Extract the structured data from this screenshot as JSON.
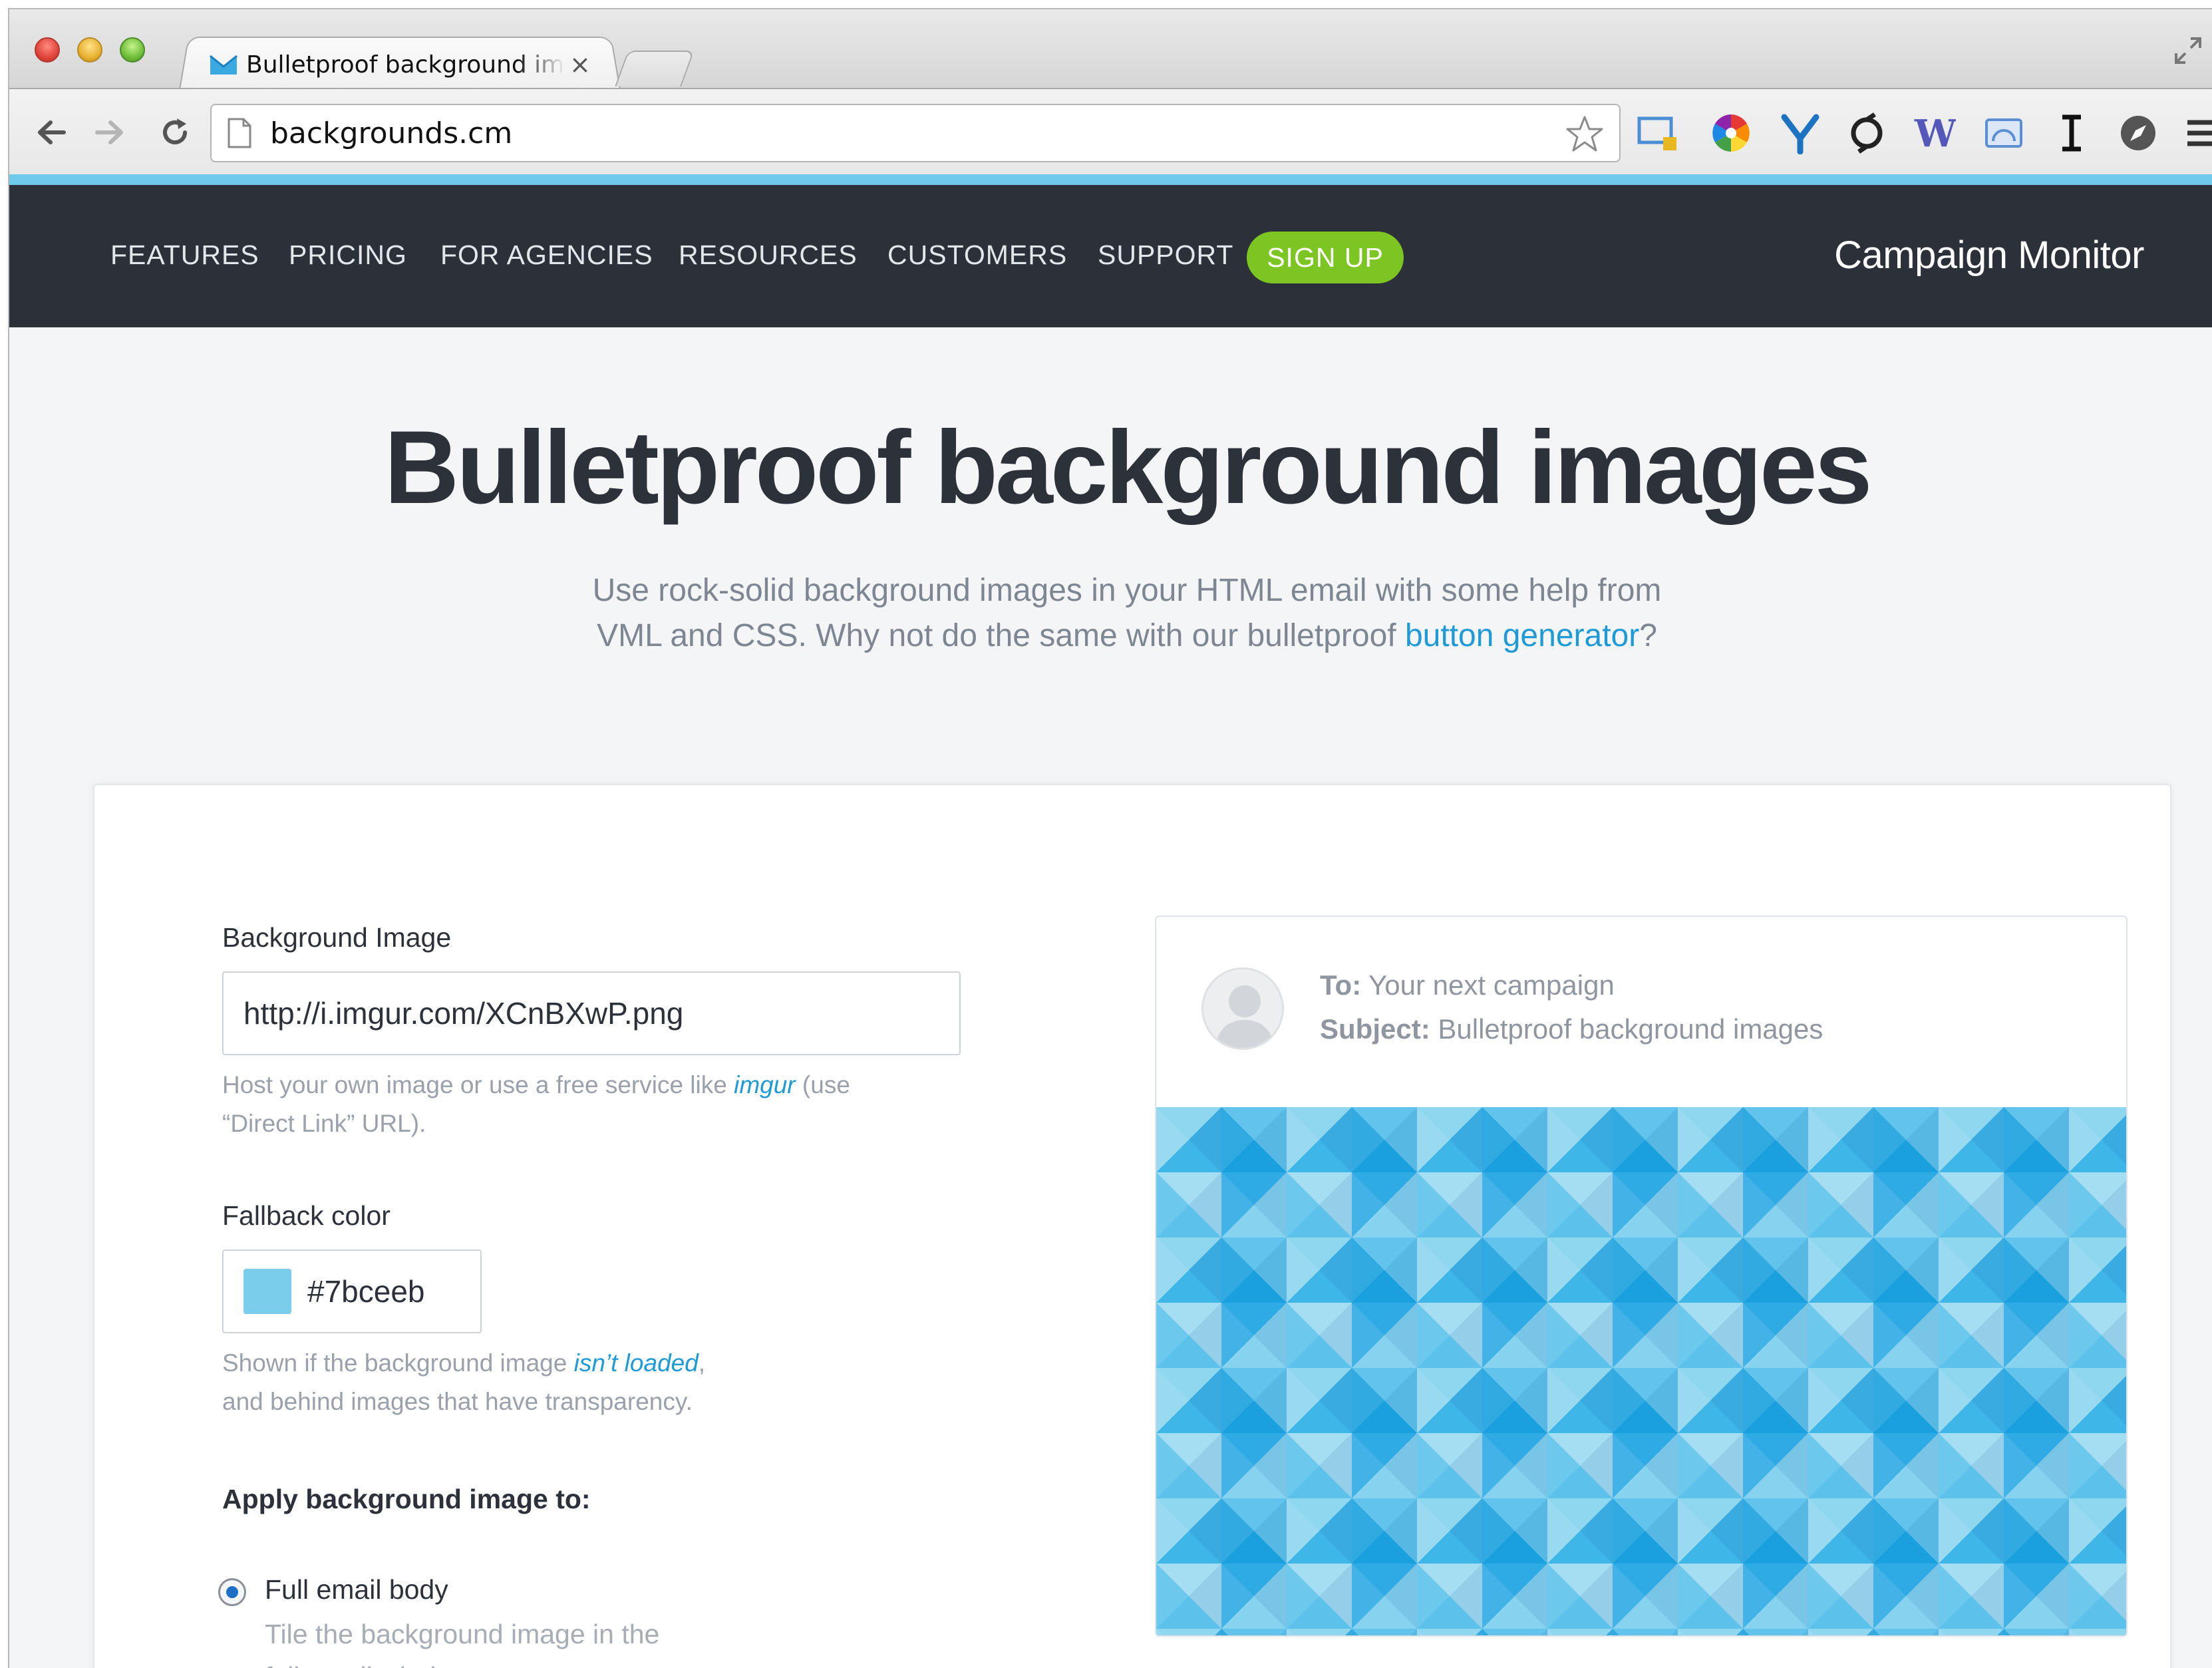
{
  "browser": {
    "tab_title": "Bulletproof background im",
    "tab_close": "×",
    "url": "backgrounds.cm"
  },
  "site": {
    "nav": [
      "FEATURES",
      "PRICING",
      "FOR AGENCIES",
      "RESOURCES",
      "CUSTOMERS",
      "SUPPORT"
    ],
    "signup": "SIGN UP",
    "brand": "Campaign Monitor"
  },
  "hero": {
    "title": "Bulletproof background images",
    "sub_line1": "Use rock-solid background images in your HTML email with some help from",
    "sub_line2_prefix": "VML and CSS. Why not do the same with our bulletproof ",
    "sub_link": "button generator",
    "sub_line2_suffix": "?"
  },
  "form": {
    "bg_label": "Background Image",
    "bg_value": "http://i.imgur.com/XCnBXwP.png",
    "bg_hint_prefix": "Host your own image or use a free service like ",
    "bg_hint_link": "imgur",
    "bg_hint_suffix": " (use",
    "bg_hint_line2": "“Direct Link” URL).",
    "fallback_label": "Fallback color",
    "fallback_value": "#7bceeb",
    "fallback_hint_prefix": "Shown if the background image ",
    "fallback_hint_link": "isn’t loaded",
    "fallback_hint_suffix": ",",
    "fallback_hint_line2": "and behind images that have transparency.",
    "apply_heading": "Apply background image to:",
    "option_label": "Full email body",
    "option_desc_line1": "Tile the background image in the",
    "option_desc_line2": "full email window."
  },
  "preview": {
    "to_label": "To:",
    "to_value": "Your next campaign",
    "subject_label": "Subject:",
    "subject_value": "Bulletproof background images"
  },
  "colors": {
    "nav_bg": "#2b3039",
    "signup_green": "#7cc523",
    "link_blue": "#1e9ad6",
    "fallback": "#7bceeb"
  }
}
